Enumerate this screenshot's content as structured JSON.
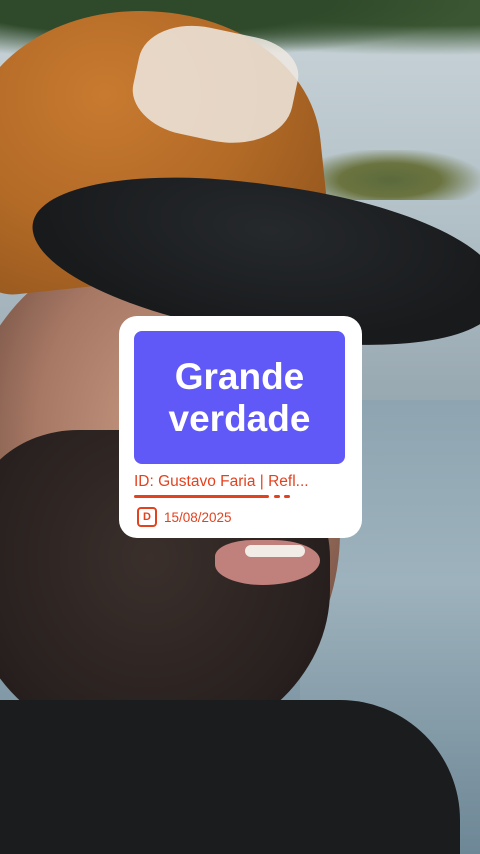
{
  "card": {
    "title": "Grande\nverdade",
    "id_line": "ID: Gustavo Faria | Refl...",
    "date_icon": "D",
    "date": "15/08/2025",
    "progress": 0.66
  },
  "colors": {
    "title_bg": "#6059f7",
    "accent": "#e3421f",
    "card_bg": "#ffffff"
  },
  "icons": [
    "calendar-day-icon"
  ]
}
